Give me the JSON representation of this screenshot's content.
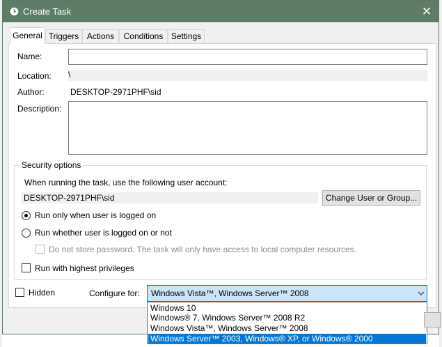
{
  "window": {
    "title": "Create Task",
    "close": "✕"
  },
  "tabs": [
    {
      "label": "General",
      "active": true
    },
    {
      "label": "Triggers",
      "active": false
    },
    {
      "label": "Actions",
      "active": false
    },
    {
      "label": "Conditions",
      "active": false
    },
    {
      "label": "Settings",
      "active": false
    }
  ],
  "general": {
    "name_label": "Name:",
    "name_value": "",
    "location_label": "Location:",
    "location_value": "\\",
    "author_label": "Author:",
    "author_value": "DESKTOP-2971PHF\\sid",
    "description_label": "Description:",
    "description_value": ""
  },
  "security": {
    "title": "Security options",
    "account_prompt": "When running the task, use the following user account:",
    "account_value": "DESKTOP-2971PHF\\sid",
    "change_button": "Change User or Group...",
    "radio_logged_on": "Run only when user is logged on",
    "radio_logged_on_checked": true,
    "radio_whether": "Run whether user is logged on or not",
    "radio_whether_checked": false,
    "no_store_password": "Do not store password.  The task will only have access to local computer resources.",
    "highest_privileges": "Run with highest privileges"
  },
  "bottom": {
    "hidden_label": "Hidden",
    "configure_label": "Configure for:",
    "configure_value": "Windows Vista™, Windows Server™ 2008",
    "options": [
      {
        "label": "Windows 10",
        "selected": false
      },
      {
        "label": "Windows® 7, Windows Server™ 2008 R2",
        "selected": false
      },
      {
        "label": "Windows Vista™, Windows Server™ 2008",
        "selected": false
      },
      {
        "label": "Windows Server™ 2003, Windows® XP, or Windows® 2000",
        "selected": true
      }
    ]
  },
  "colors": {
    "titlebar": "#5f7c66",
    "selection": "#0078d7",
    "combo_highlight": "#cce4f7"
  }
}
